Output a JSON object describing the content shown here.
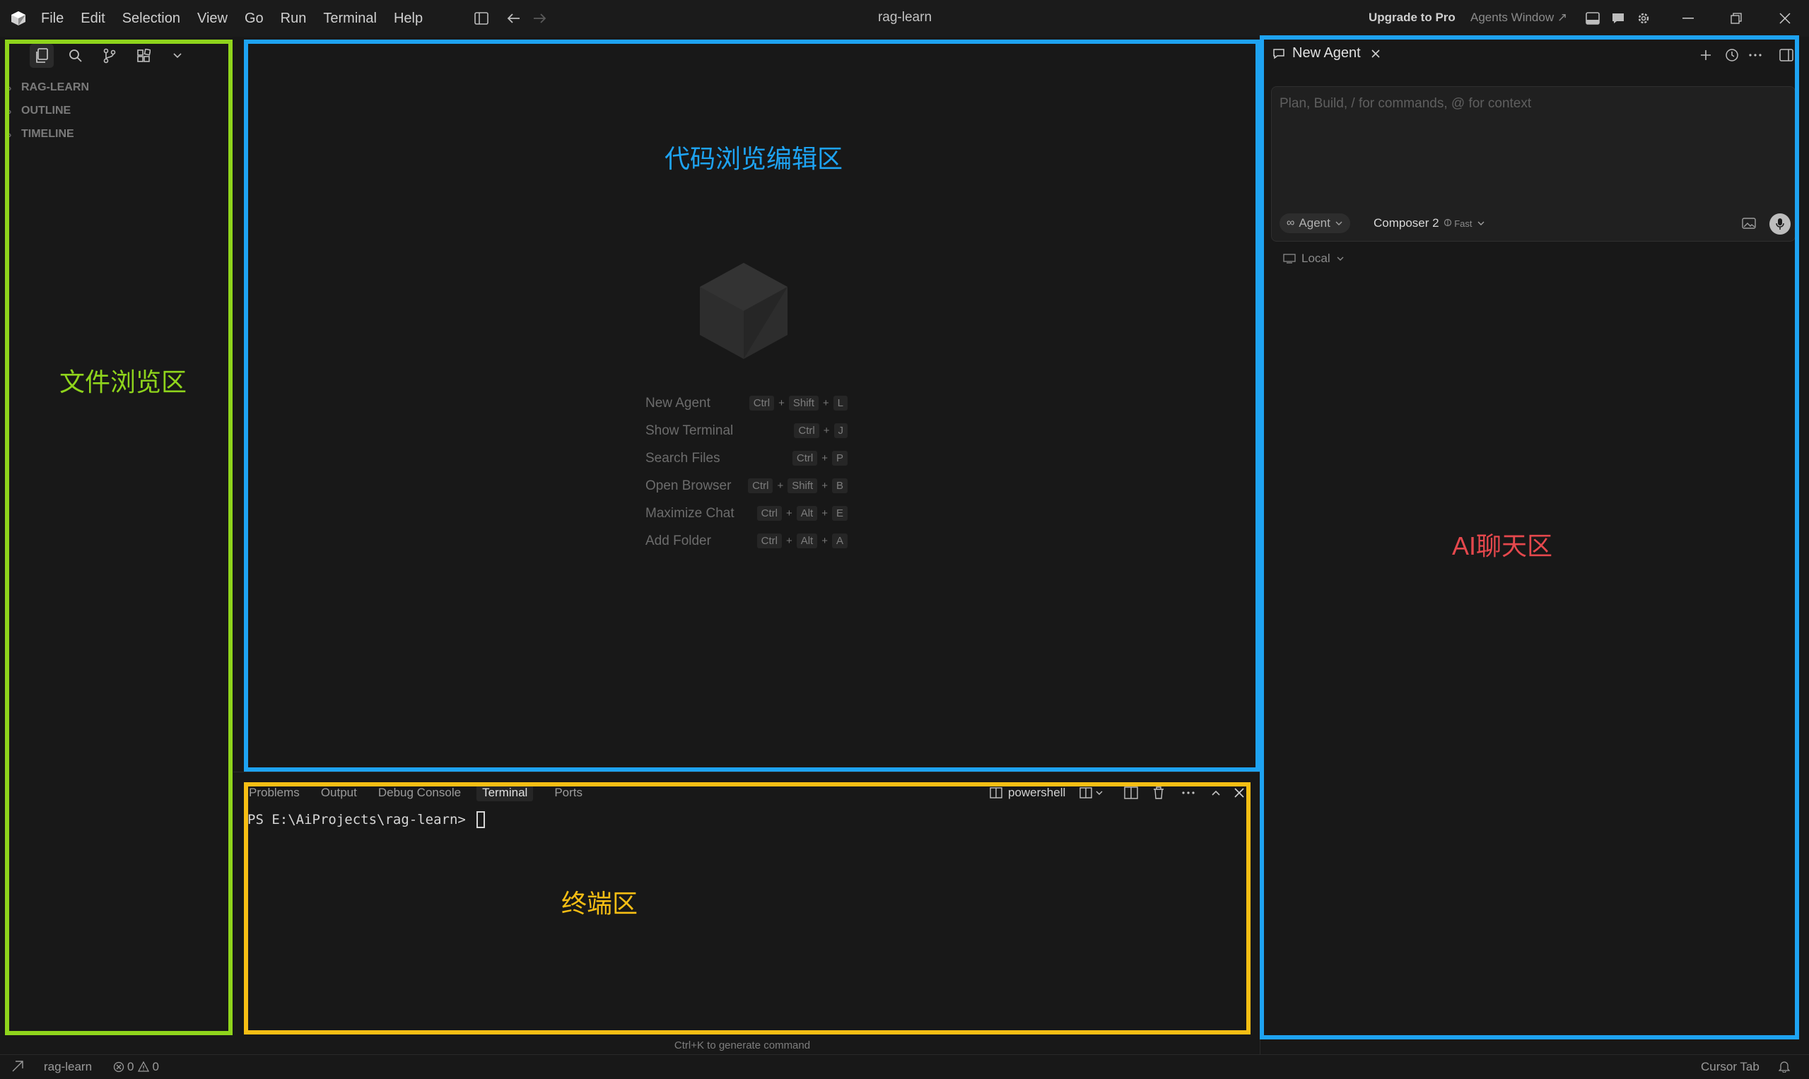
{
  "titlebar": {
    "menu": [
      "File",
      "Edit",
      "Selection",
      "View",
      "Go",
      "Run",
      "Terminal",
      "Help"
    ],
    "title": "rag-learn",
    "upgrade": "Upgrade to Pro",
    "agents_window": "Agents Window ↗"
  },
  "sidebar": {
    "sections": [
      "RAG-LEARN",
      "OUTLINE",
      "TIMELINE"
    ]
  },
  "editor": {
    "shortcuts": [
      {
        "label": "New Agent",
        "keys": [
          "Ctrl",
          "Shift",
          "L"
        ]
      },
      {
        "label": "Show Terminal",
        "keys": [
          "Ctrl",
          "J"
        ]
      },
      {
        "label": "Search Files",
        "keys": [
          "Ctrl",
          "P"
        ]
      },
      {
        "label": "Open Browser",
        "keys": [
          "Ctrl",
          "Shift",
          "B"
        ]
      },
      {
        "label": "Maximize Chat",
        "keys": [
          "Ctrl",
          "Alt",
          "E"
        ]
      },
      {
        "label": "Add Folder",
        "keys": [
          "Ctrl",
          "Alt",
          "A"
        ]
      }
    ]
  },
  "panel": {
    "tabs": [
      "Problems",
      "Output",
      "Debug Console",
      "Terminal",
      "Ports"
    ],
    "active_tab": "Terminal",
    "shell": "powershell",
    "prompt": "PS E:\\AiProjects\\rag-learn> ",
    "hint": "Ctrl+K to generate command"
  },
  "chat": {
    "tab_title": "New Agent",
    "placeholder": "Plan, Build, / for commands, @ for context",
    "mode": "Agent",
    "model": "Composer 2",
    "speed": "Fast",
    "location": "Local"
  },
  "annotations": {
    "files": "文件浏览区",
    "editor": "代码浏览编辑区",
    "terminal": "终端区",
    "chat": "AI聊天区",
    "colors": {
      "files": "#8fd41c",
      "editor": "#1ea3f2",
      "terminal": "#f6be14",
      "chat": "#e5484d"
    }
  },
  "statusbar": {
    "workspace": "rag-learn",
    "errors": "0",
    "warnings": "0",
    "cursor_tab": "Cursor Tab"
  }
}
